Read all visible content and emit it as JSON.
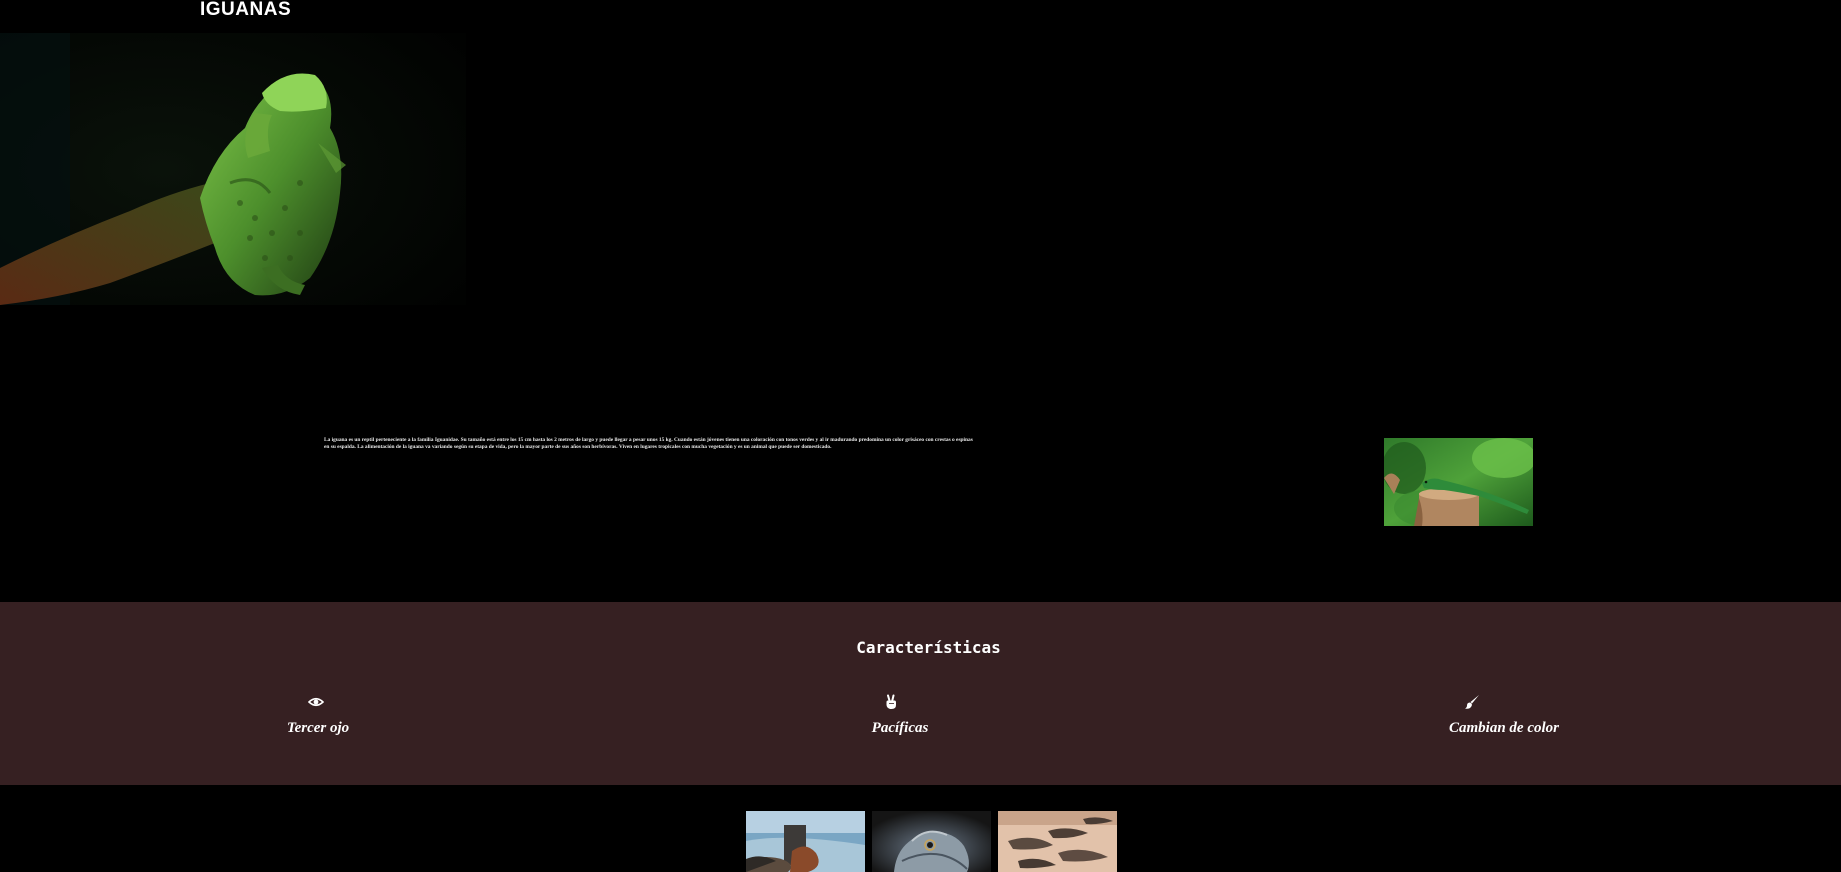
{
  "header": {
    "title": "IGUANAS"
  },
  "intro": {
    "text": "La iguana es un reptil perteneciente a la familia Iguanidae. Su tamaño está entre los 15 cm hasta los 2 metros de largo y puede llegar a pesar unos 15 kg. Cuando están jóvenes tienen una coloración con tonos verdes y al ir madurando predomina un color grisáceo con crestas o espinas en su espalda. La alimentación de la iguana va variando según su etapa de vida, pero la mayor parte de sus años son herbívoras. Viven en lugares tropicales con mucha vegetación y es un animal que puede ser domesticado."
  },
  "features": {
    "title": "Características",
    "items": [
      {
        "icon": "eye-icon",
        "label": "Tercer ojo"
      },
      {
        "icon": "peace-hand-icon",
        "label": "Pacíficas"
      },
      {
        "icon": "paintbrush-icon",
        "label": "Cambian de color"
      }
    ]
  },
  "colors": {
    "page_background": "#000000",
    "features_background": "#362022",
    "text": "#ffffff"
  }
}
